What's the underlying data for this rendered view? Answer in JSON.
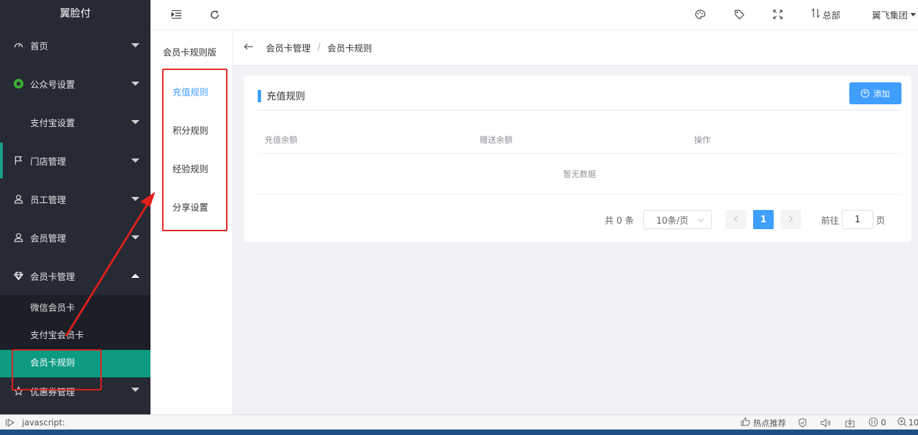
{
  "sidebar": {
    "logo": "翼脸付",
    "items": [
      {
        "label": "首页",
        "icon": "dashboard-icon"
      },
      {
        "label": "公众号设置",
        "icon": "wechat-icon"
      },
      {
        "label": "支付宝设置",
        "icon": ""
      },
      {
        "label": "门店管理",
        "icon": "flag-icon"
      },
      {
        "label": "员工管理",
        "icon": "user-icon"
      },
      {
        "label": "会员管理",
        "icon": "user-icon"
      },
      {
        "label": "会员卡管理",
        "icon": "diamond-icon"
      }
    ],
    "submenu": [
      "微信会员卡",
      "支付宝会员卡",
      "会员卡规则"
    ],
    "last_item": {
      "label": "优惠券管理",
      "icon": "star-icon"
    }
  },
  "header": {
    "branch": "总部",
    "company": "翼飞集团"
  },
  "subpanel": {
    "title": "会员卡规则版",
    "items": [
      "充值规则",
      "积分规则",
      "经验规则",
      "分享设置"
    ]
  },
  "breadcrumb": {
    "items": [
      "会员卡管理",
      "会员卡规则"
    ],
    "separator": "/"
  },
  "card": {
    "title": "充值规则",
    "add_label": "添加",
    "columns": [
      "充值余额",
      "赠送余额",
      "操作"
    ],
    "empty_text": "暂无数据"
  },
  "pagination": {
    "total_text": "共 0 条",
    "page_size": "10条/页",
    "current_page": "1",
    "goto_label": "前往",
    "goto_value": "1",
    "page_unit": "页"
  },
  "statusbar": {
    "url": "javascript:",
    "hot": "热点推荐",
    "count": "0",
    "zoom": "10"
  },
  "colors": {
    "sidebar_bg": "#262a35",
    "active_teal": "#0d9b82",
    "primary_blue": "#409eff",
    "annotation_red": "#e0201b"
  }
}
